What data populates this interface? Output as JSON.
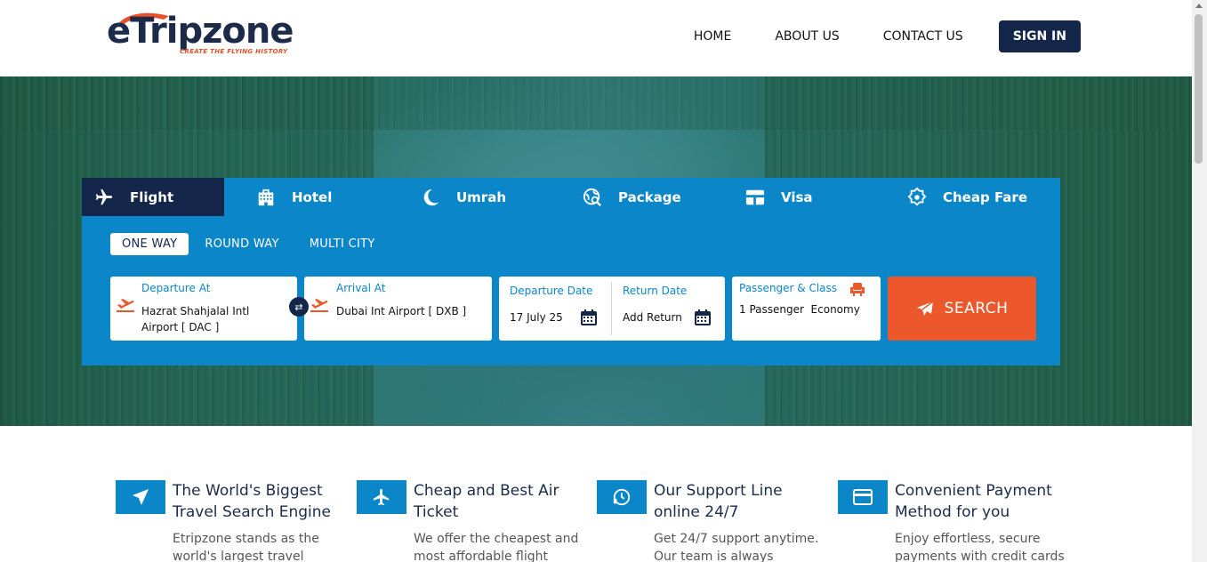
{
  "brand": {
    "name": "eTripzone",
    "tagline": "CREATE THE FLYING HISTORY",
    "colors": {
      "navy": "#14264a",
      "blue": "#0b87c9",
      "orange": "#ec582b"
    }
  },
  "nav": {
    "home": "HOME",
    "about": "ABOUT US",
    "contact": "CONTACT US",
    "signin": "SIGN IN"
  },
  "tabs": [
    {
      "label": "Flight",
      "icon": "airplane-icon",
      "active": true
    },
    {
      "label": "Hotel",
      "icon": "building-icon"
    },
    {
      "label": "Umrah",
      "icon": "crescent-moon-icon"
    },
    {
      "label": "Package",
      "icon": "globe-search-icon"
    },
    {
      "label": "Visa",
      "icon": "card-icon"
    },
    {
      "label": "Cheap Fare",
      "icon": "badge-icon"
    }
  ],
  "trip_types": [
    "ONE WAY",
    "ROUND WAY",
    "MULTI CITY"
  ],
  "search": {
    "departure": {
      "label": "Departure At",
      "value_line1": "Hazrat Shahjalal Intl",
      "value_line2": "Airport [ DAC ]"
    },
    "arrival": {
      "label": "Arrival At",
      "value": "Dubai Int Airport [ DXB ]"
    },
    "departure_date": {
      "label": "Departure Date",
      "value": "17 July 25"
    },
    "return_date": {
      "label": "Return Date",
      "value": "Add Return"
    },
    "passenger": {
      "label": "Passenger & Class",
      "value": "1 Passenger  Economy"
    },
    "button": "SEARCH"
  },
  "features": [
    {
      "title": "The World's Biggest Travel Search Engine",
      "desc": "Etripzone stands as the world's largest travel",
      "icon": "paper-plane-icon"
    },
    {
      "title": "Cheap and Best Air Ticket",
      "desc": "We offer the cheapest and most affordable flight",
      "icon": "airplane-icon"
    },
    {
      "title": "Our Support Line online 24/7",
      "desc": "Get 24/7 support anytime. Our team is always",
      "icon": "support-clock-icon"
    },
    {
      "title": "Convenient Payment Method for you",
      "desc": "Enjoy effortless, secure payments with credit cards",
      "icon": "credit-card-icon"
    }
  ]
}
